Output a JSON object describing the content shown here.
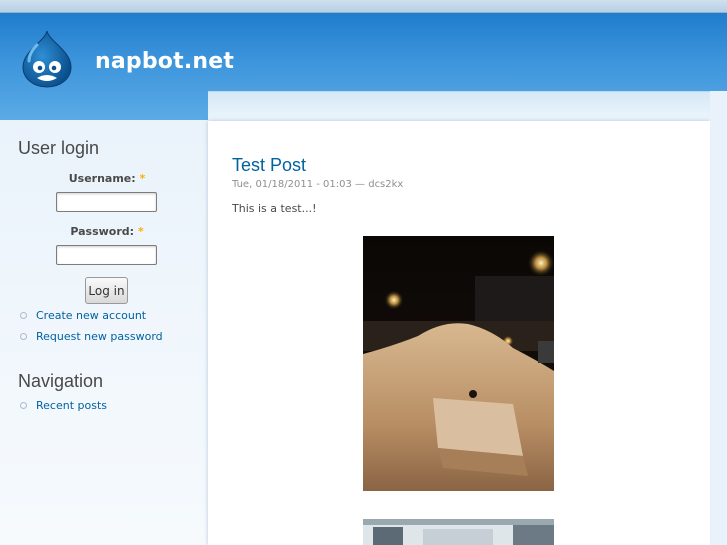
{
  "site": {
    "name": "napbot.net"
  },
  "user_login": {
    "title": "User login",
    "username_label": "Username:",
    "password_label": "Password:",
    "required_marker": "*",
    "username_value": "",
    "password_value": "",
    "login_button": "Log in",
    "links": [
      "Create new account",
      "Request new password"
    ]
  },
  "navigation": {
    "title": "Navigation",
    "links": [
      "Recent posts"
    ]
  },
  "post": {
    "title": "Test Post",
    "meta": "Tue, 01/18/2011 - 01:03 — dcs2kx",
    "body": "This is a test...!"
  },
  "colors": {
    "header": "#3d95db",
    "link": "#0062a0",
    "required": "#ffae00"
  }
}
